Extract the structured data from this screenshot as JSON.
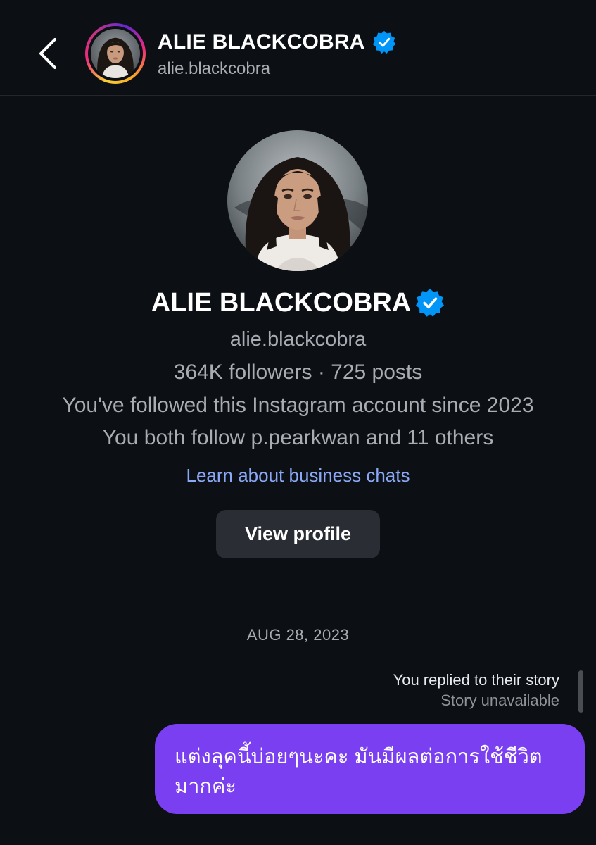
{
  "header": {
    "name": "ALIE BLACKCOBRA",
    "username": "alie.blackcobra",
    "verified_icon": "verified-badge-icon",
    "back_icon": "chevron-left-icon"
  },
  "profile": {
    "name": "ALIE BLACKCOBRA",
    "username": "alie.blackcobra",
    "stats": "364K followers · 725 posts",
    "followed_since": "You've followed this Instagram account since 2023",
    "mutual": "You both follow p.pearkwan and 11 others",
    "learn_link": "Learn about business chats",
    "view_profile_label": "View profile"
  },
  "conversation": {
    "date": "AUG 28, 2023",
    "reply_label": "You replied to their story",
    "story_status": "Story unavailable",
    "message": "แต่งลุคนี้บ่อยๆนะคะ มันมีผลต่อการใช้ชีวิตมากค่ะ"
  },
  "colors": {
    "background": "#0c1014",
    "verified": "#0095f6",
    "link": "#8aa8f5",
    "bubble": "#7b3ff2",
    "button": "#2a2d33"
  }
}
